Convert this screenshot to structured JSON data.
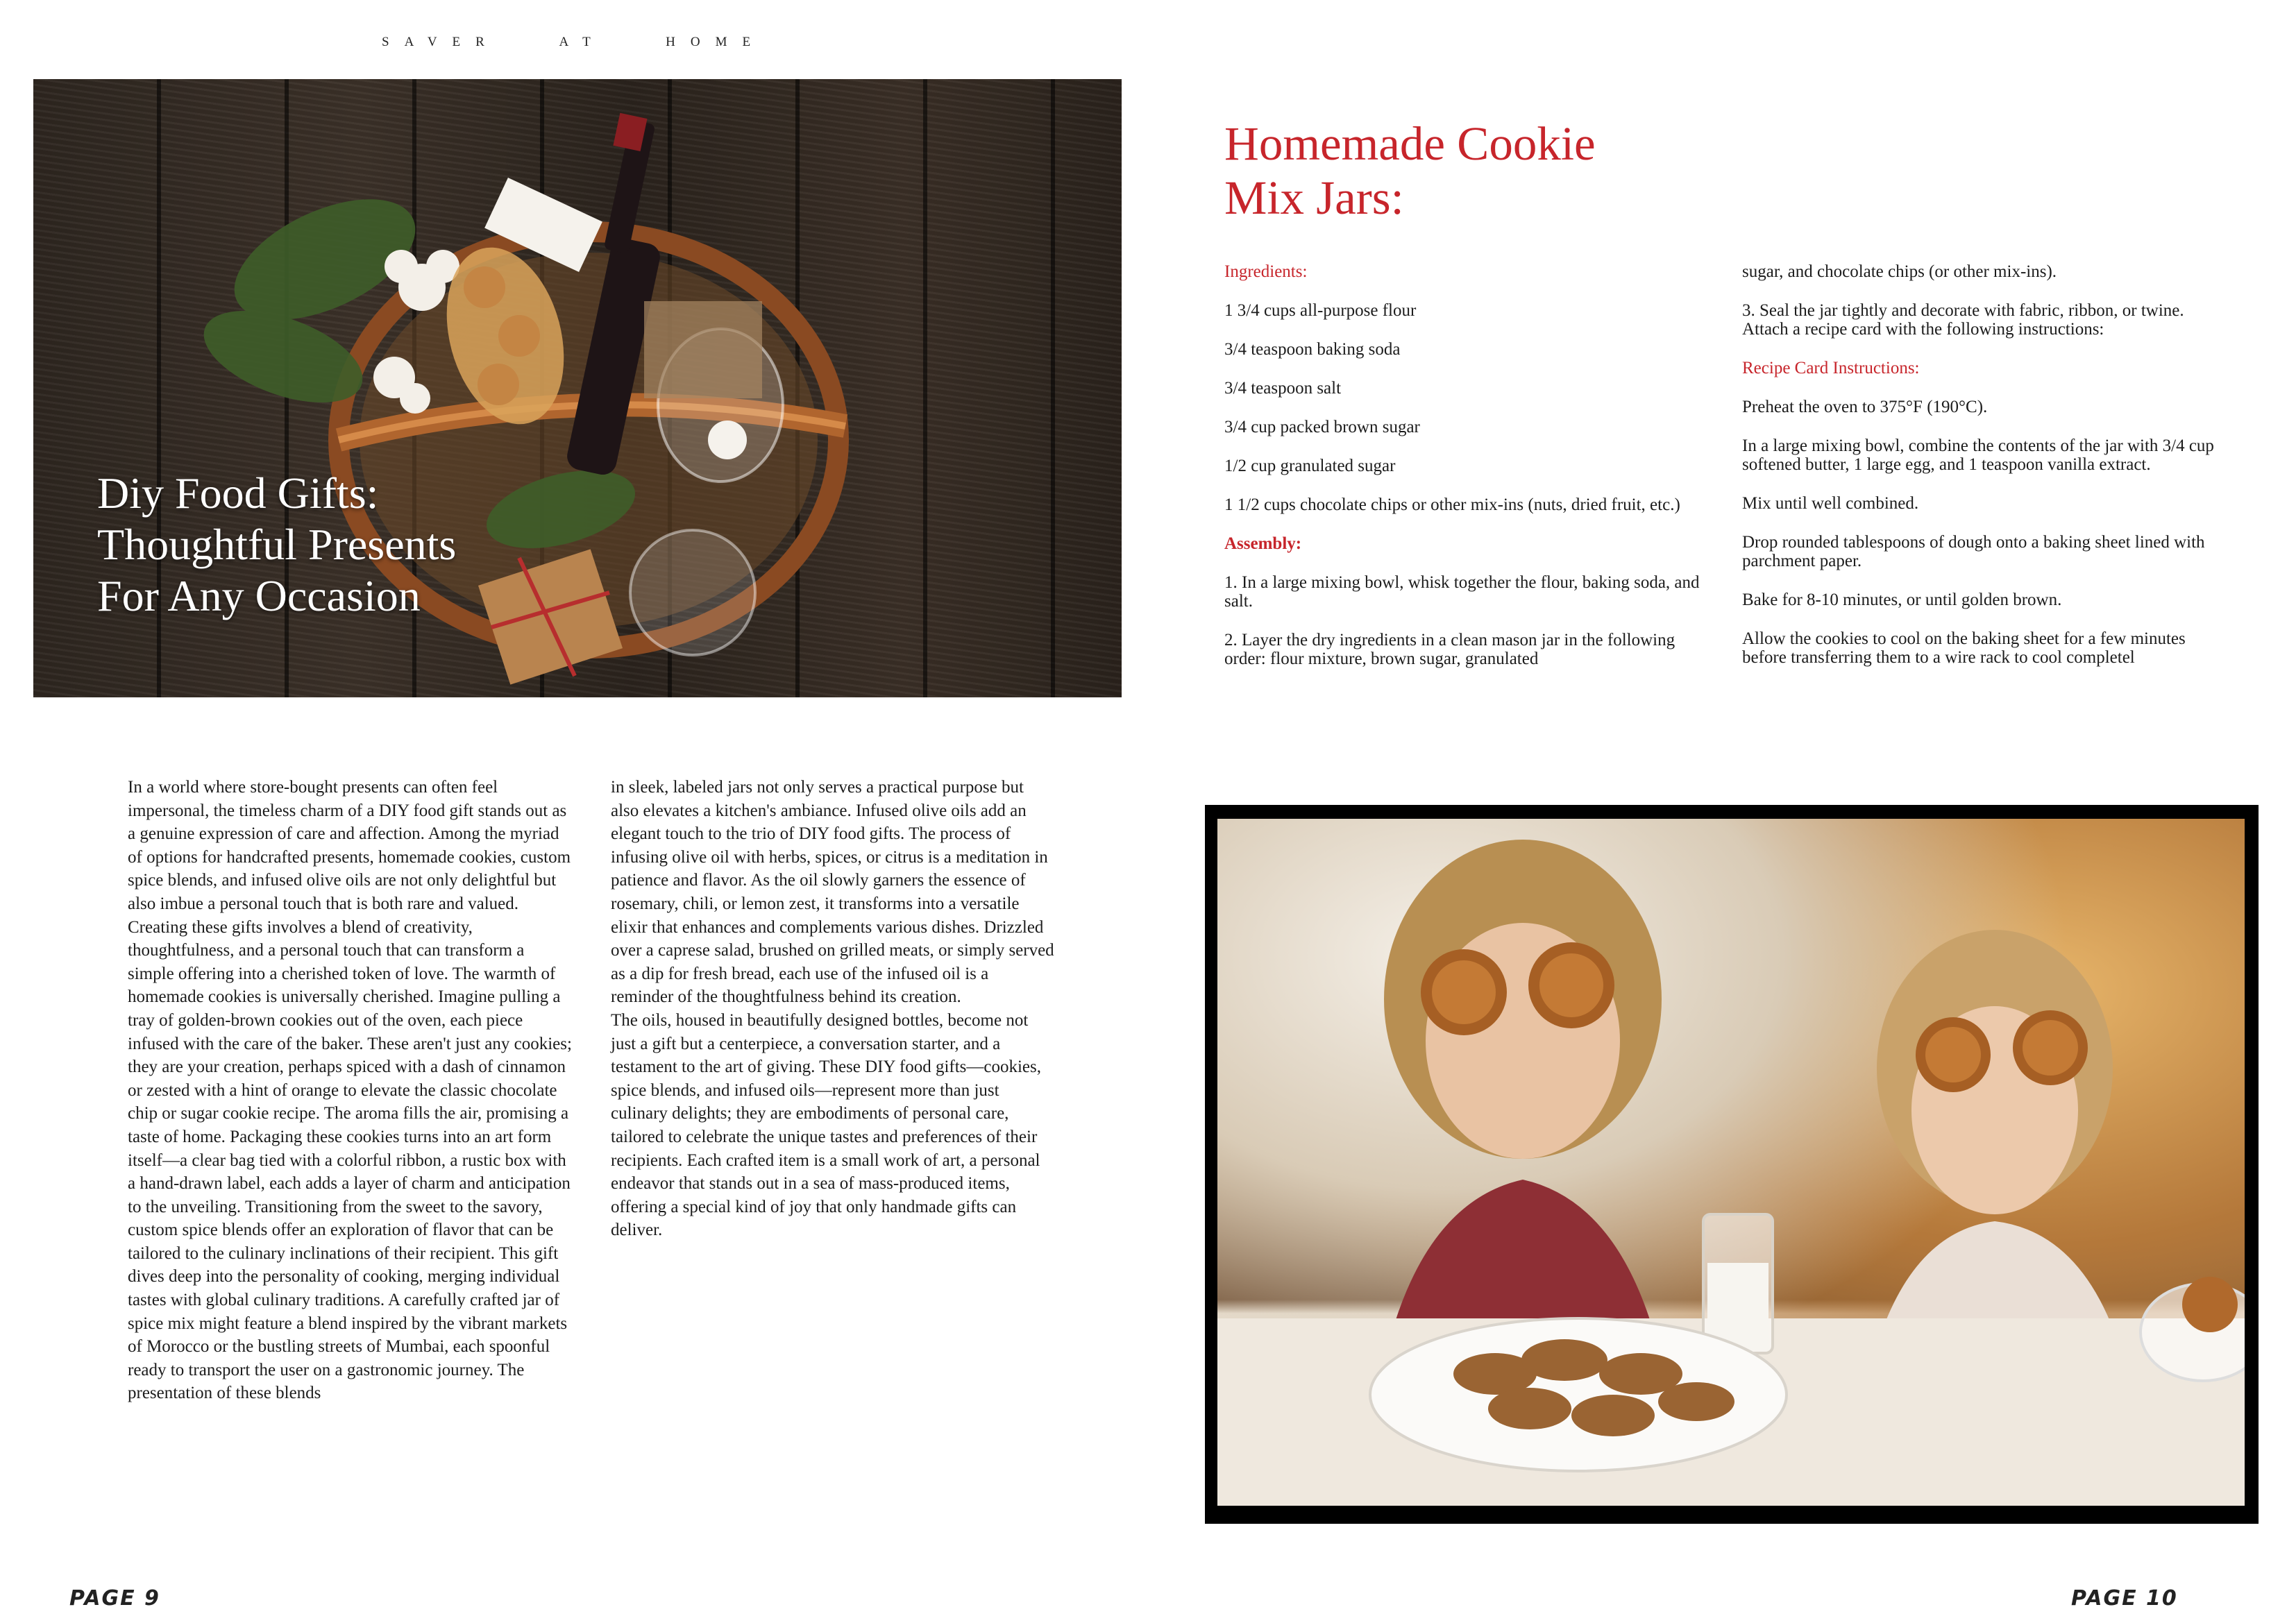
{
  "header": {
    "magazine_name": "SAVER AT HOME"
  },
  "left_page": {
    "hero_title_lines": [
      "Diy Food Gifts:",
      "Thoughtful Presents",
      "For Any Occasion"
    ],
    "column1": "In a world where store-bought presents can often feel impersonal, the timeless charm of a DIY food gift stands out as a genuine expression of care and affection. Among the myriad of options for handcrafted presents, homemade cookies, custom spice blends, and infused olive oils are not only delightful but also imbue a personal touch that is both rare and valued. Creating these gifts involves a blend of creativity, thoughtfulness, and a personal touch that can transform a simple offering into a cherished token of love. The warmth of homemade cookies is universally cherished. Imagine pulling a tray of golden-brown cookies out of the oven, each piece infused with the care of the baker. These aren't just any cookies; they are your creation, perhaps spiced with a dash of cinnamon or zested with a hint of orange to elevate the classic chocolate chip or sugar cookie recipe. The aroma fills the air, promising a taste of home. Packaging these cookies turns into an art form itself—a clear bag tied with a colorful ribbon, a rustic box with a hand-drawn label, each adds a layer of charm and anticipation to the unveiling. Transitioning from the sweet to the savory, custom spice blends offer an exploration of flavor that can be tailored to the culinary inclinations of their recipient. This gift dives deep into the personality of cooking, merging individual tastes with global culinary traditions. A carefully crafted jar of spice mix might feature a blend inspired by the vibrant markets of Morocco or the bustling streets of Mumbai, each spoonful ready to transport the user on a gastronomic journey. The presentation of these blends",
    "column2_p1": "in sleek, labeled jars not only serves a practical purpose but also elevates a kitchen's ambiance. Infused olive oils add an elegant touch to the trio of DIY food gifts. The process of infusing olive oil with herbs, spices, or citrus is a meditation in patience and flavor. As the oil slowly garners the essence of rosemary, chili, or lemon zest, it transforms into a versatile elixir that enhances and complements various dishes. Drizzled over a caprese salad, brushed on grilled meats, or simply served as a dip for fresh bread, each use of the infused oil is a reminder of the thoughtfulness behind its creation.",
    "column2_p2": "The oils, housed in beautifully designed bottles, become not just a gift but a centerpiece, a conversation starter, and a testament to the art of giving. These DIY food gifts—cookies, spice blends, and infused oils—represent more than just culinary delights; they are embodiments of personal care, tailored to celebrate the unique tastes and preferences of their recipients. Each crafted item is a small work of art, a personal endeavor that stands out in a sea of mass-produced items, offering a special kind of joy that only handmade gifts can deliver.",
    "page_number": "PAGE 9"
  },
  "right_page": {
    "title_lines": [
      "Homemade Cookie",
      "Mix Jars:"
    ],
    "ingredients_heading": "Ingredients:",
    "ingredients": [
      "1 3/4 cups all-purpose flour",
      "3/4 teaspoon baking soda",
      "3/4 teaspoon salt",
      "3/4 cup packed brown sugar",
      "1/2 cup granulated sugar",
      "1 1/2 cups chocolate chips or other mix-ins (nuts, dried fruit, etc.)"
    ],
    "assembly_heading": "Assembly:",
    "assembly_1": "1. In a large mixing bowl, whisk together the flour, baking soda, and salt.",
    "assembly_2": "2. Layer the dry ingredients in a clean mason jar in the following order: flour mixture, brown sugar, granulated",
    "assembly_2_cont": "sugar, and chocolate chips (or other mix-ins).",
    "assembly_3": "3. Seal the jar tightly and decorate with fabric, ribbon, or twine. Attach a recipe card with the following instructions:",
    "recipe_card_heading": "Recipe Card Instructions:",
    "recipe_card_steps": [
      "Preheat the oven to 375°F (190°C).",
      "In a large mixing bowl, combine the contents of the jar with 3/4 cup softened butter, 1 large egg, and 1 teaspoon vanilla extract.",
      "Mix until well combined.",
      "Drop rounded tablespoons of dough onto a baking sheet lined with parchment paper.",
      "Bake for 8-10 minutes, or until golden brown.",
      "Allow the cookies to cool on the baking sheet for a few minutes before transferring them to a wire rack to cool completel"
    ],
    "page_number": "PAGE 10"
  }
}
